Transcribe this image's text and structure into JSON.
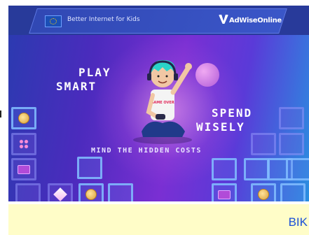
{
  "header": {
    "left_label": "Better Internet for Kids",
    "logo_text": "AdWiseOnline"
  },
  "game": {
    "title_left_1": "PLAY",
    "title_left_2": "SMART",
    "title_right_1": "SPEND",
    "title_right_2": "WISELY",
    "subtitle": "MIND THE HIDDEN COSTS",
    "shirt_text": "GAME OVER"
  },
  "inventory": {
    "left_slots": [
      "coin",
      "dots",
      "card",
      "empty",
      "diamond",
      "coin",
      "empty"
    ],
    "right_slots": [
      "empty",
      "empty",
      "empty",
      "empty",
      "empty",
      "empty",
      "empty",
      "empty",
      "card",
      "coin",
      "empty"
    ]
  },
  "footer": {
    "label": "BIK"
  },
  "colors": {
    "accent_blue": "#1a4fd8",
    "footer_bg": "#fffdc8"
  }
}
